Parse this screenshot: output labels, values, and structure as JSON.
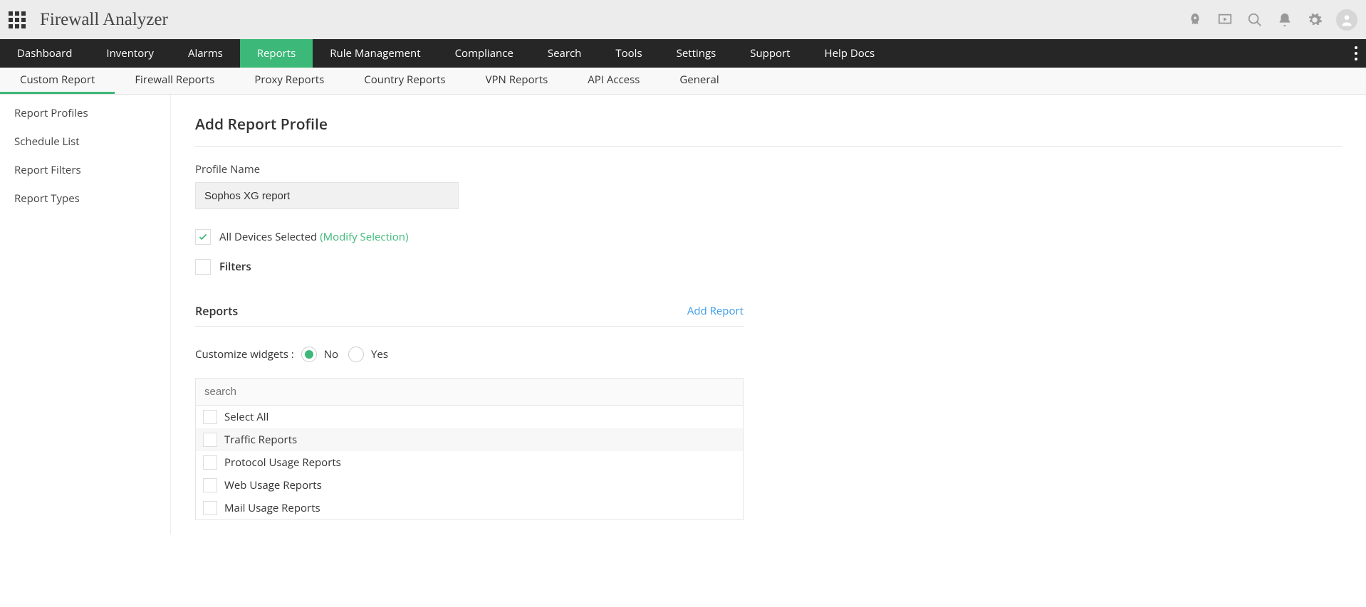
{
  "app_title": "Firewall Analyzer",
  "main_nav": {
    "items": [
      "Dashboard",
      "Inventory",
      "Alarms",
      "Reports",
      "Rule Management",
      "Compliance",
      "Search",
      "Tools",
      "Settings",
      "Support",
      "Help Docs"
    ],
    "active_index": 3
  },
  "sub_nav": {
    "items": [
      "Custom Report",
      "Firewall Reports",
      "Proxy Reports",
      "Country Reports",
      "VPN Reports",
      "API Access",
      "General"
    ],
    "active_index": 0
  },
  "left_sidebar": {
    "items": [
      "Report Profiles",
      "Schedule List",
      "Report Filters",
      "Report Types"
    ]
  },
  "page": {
    "title": "Add Report Profile",
    "profile_name_label": "Profile Name",
    "profile_name_value": "Sophos XG report",
    "all_devices_label": "All Devices Selected",
    "modify_selection_label": "(Modify Selection)",
    "filters_label": "Filters",
    "reports_section_title": "Reports",
    "add_report_link": "Add Report",
    "customize_label": "Customize widgets :",
    "radio_no": "No",
    "radio_yes": "Yes",
    "search_placeholder": "search",
    "report_items": [
      "Select All",
      "Traffic Reports",
      "Protocol Usage Reports",
      "Web Usage Reports",
      "Mail Usage Reports"
    ]
  },
  "icons": {
    "rocket": "rocket-icon",
    "presentation": "presentation-icon",
    "search": "search-icon",
    "bell": "bell-icon",
    "gear": "gear-icon",
    "avatar": "avatar"
  }
}
